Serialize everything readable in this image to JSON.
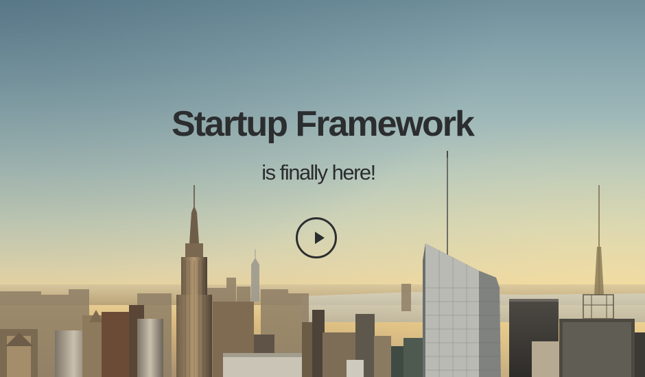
{
  "hero": {
    "title": "Startup Framework",
    "subtitle": "is finally here!",
    "play_icon": "play-icon",
    "text_color": "#2b2d2f"
  }
}
